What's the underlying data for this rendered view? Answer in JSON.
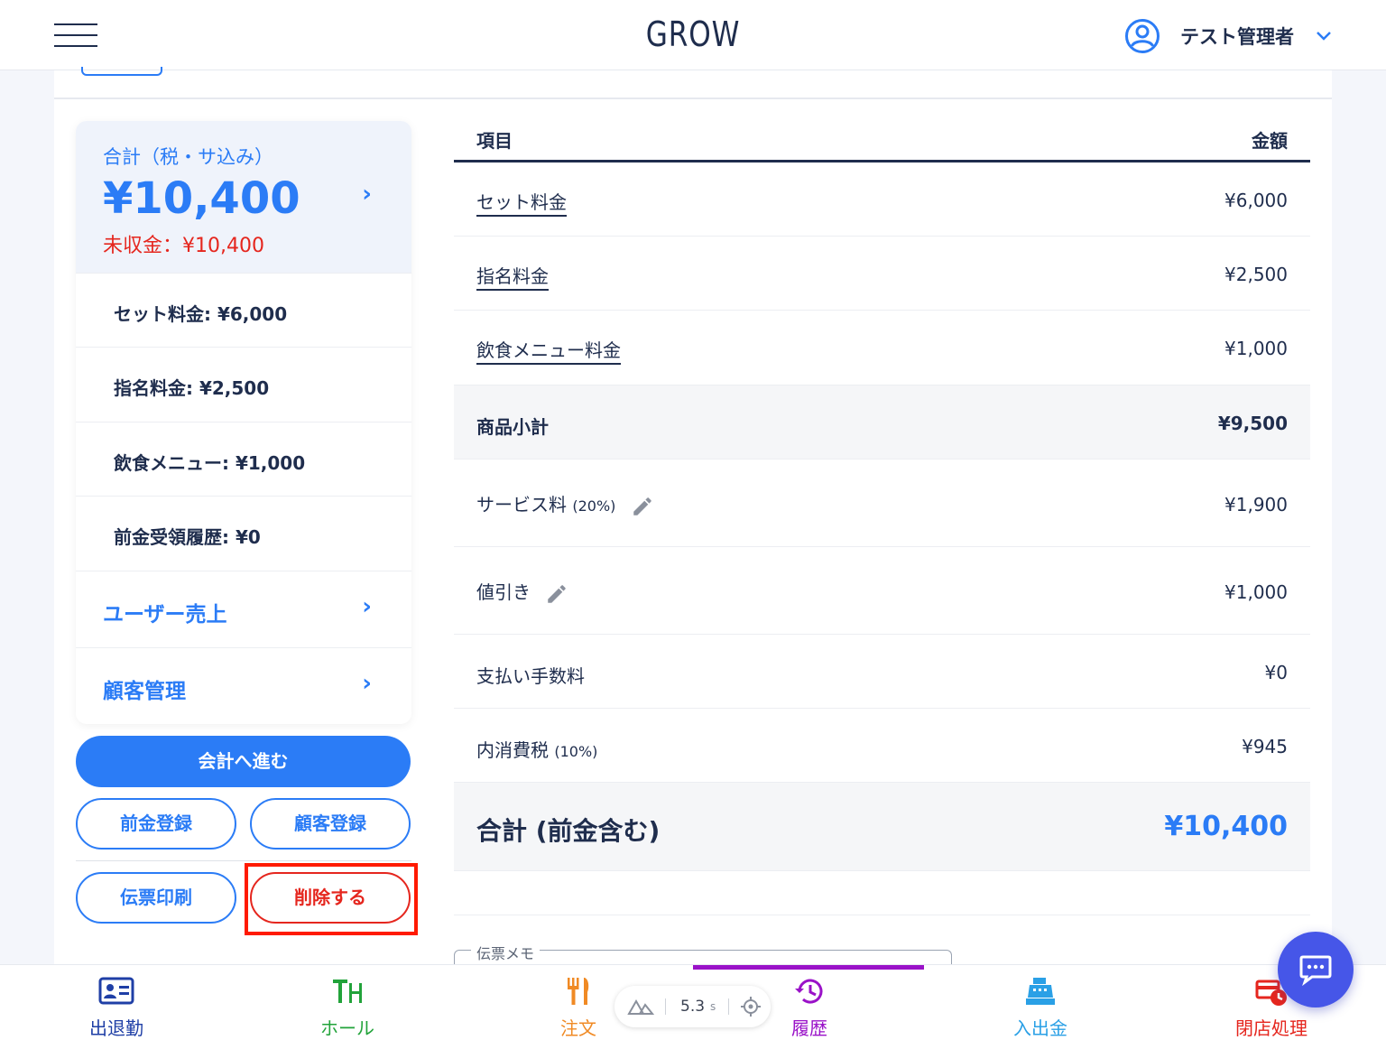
{
  "header": {
    "logo": "GROW",
    "user_name": "テスト管理者"
  },
  "summary": {
    "total_label": "合計（税・サ込み）",
    "total_value": "¥10,400",
    "unpaid": "未収金：¥10,400",
    "rows": [
      "セット料金: ¥6,000",
      "指名料金: ¥2,500",
      "飲食メニュー: ¥1,000",
      "前金受領履歴: ¥0"
    ],
    "links": [
      "ユーザー売上",
      "顧客管理"
    ]
  },
  "actions": {
    "checkout": "会計へ進む",
    "deposit": "前金登録",
    "customer": "顧客登録",
    "print": "伝票印刷",
    "delete": "削除する"
  },
  "table": {
    "col_item": "項目",
    "col_amount": "金額",
    "rows": [
      {
        "label": "セット料金",
        "amount": "¥6,000"
      },
      {
        "label": "指名料金",
        "amount": "¥2,500"
      },
      {
        "label": "飲食メニュー料金",
        "amount": "¥1,000"
      },
      {
        "label": "商品小計",
        "amount": "¥9,500"
      },
      {
        "label": "サービス料",
        "note": "(20%)",
        "amount": "¥1,900"
      },
      {
        "label": "値引き",
        "amount": "¥1,000"
      },
      {
        "label": "支払い手数料",
        "amount": "¥0"
      },
      {
        "label": "内消費税",
        "note": "(10%)",
        "amount": "¥945"
      },
      {
        "label": "合計 (前金含む)",
        "amount": "¥10,400"
      }
    ],
    "memo_label": "伝票メモ"
  },
  "nav": [
    {
      "label": "出退勤",
      "icon": "id-card-icon",
      "color": "#1f3fa6"
    },
    {
      "label": "ホール",
      "icon": "table-icon",
      "color": "#22a33a"
    },
    {
      "label": "注文",
      "icon": "fork-knife-icon",
      "color": "#f08a24"
    },
    {
      "label": "履歴",
      "icon": "history-icon",
      "color": "#9a12c8"
    },
    {
      "label": "入出金",
      "icon": "cash-register-icon",
      "color": "#2aa0e6"
    },
    {
      "label": "閉店処理",
      "icon": "close-store-icon",
      "color": "#e5261e"
    }
  ],
  "timer": {
    "value": "5.3",
    "unit": "s"
  },
  "colors": {
    "primary": "#2b7cf6",
    "danger": "#e5261e",
    "navy": "#1f2d4d",
    "active_tab": "#9a12c8"
  }
}
